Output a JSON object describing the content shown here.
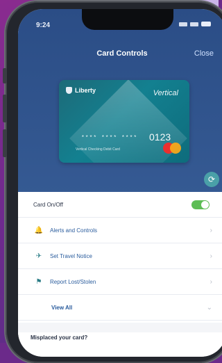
{
  "status_bar": {
    "time": "9:24"
  },
  "header": {
    "title": "Card Controls",
    "close_label": "Close"
  },
  "card": {
    "bank_name": "Liberty",
    "brand": "Vertical",
    "number_masked": "**** **** ****",
    "last_four": "0123",
    "card_type": "Vertical Checking Debit Card"
  },
  "rows": {
    "card_on_off": {
      "label": "Card On/Off",
      "on": true
    },
    "alerts": {
      "label": "Alerts and Controls"
    },
    "travel": {
      "label": "Set Travel Notice"
    },
    "lost": {
      "label": "Report Lost/Stolen"
    },
    "view_all": {
      "label": "View All"
    }
  },
  "misplaced": {
    "label": "Misplaced your card?"
  },
  "colors": {
    "header": "#2b4d86",
    "card": "#138090",
    "accent": "#5dbd55",
    "link": "#2a5c9d"
  }
}
